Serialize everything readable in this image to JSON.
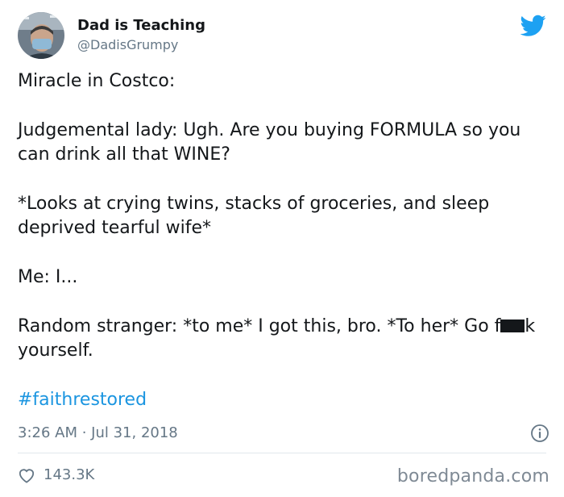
{
  "tweet": {
    "author": {
      "display_name": "Dad is Teaching",
      "handle": "@DadisGrumpy"
    },
    "lines": {
      "intro": "Miracle in Costco:",
      "lady": "Judgemental lady: Ugh. Are you buying FORMULA so you can drink all that WINE?",
      "looks": "*Looks at crying twins, stacks of groceries, and sleep deprived tearful wife*",
      "me": "Me: I...",
      "stranger_part1": "Random stranger: *to me* I got this, bro. *To her* Go f",
      "stranger_part2": "k yourself.",
      "hashtag": "#faithrestored"
    },
    "timestamp": "3:26 AM · Jul 31, 2018",
    "likes": "143.3K"
  },
  "watermark": "boredpanda.com",
  "icons": {
    "brand": "twitter-bird-icon",
    "info": "info-icon",
    "like": "heart-icon"
  },
  "colors": {
    "twitter_blue": "#1da1f2",
    "hashtag": "#1b95e0",
    "secondary_text": "#657786",
    "divider": "#e1e8ed"
  }
}
